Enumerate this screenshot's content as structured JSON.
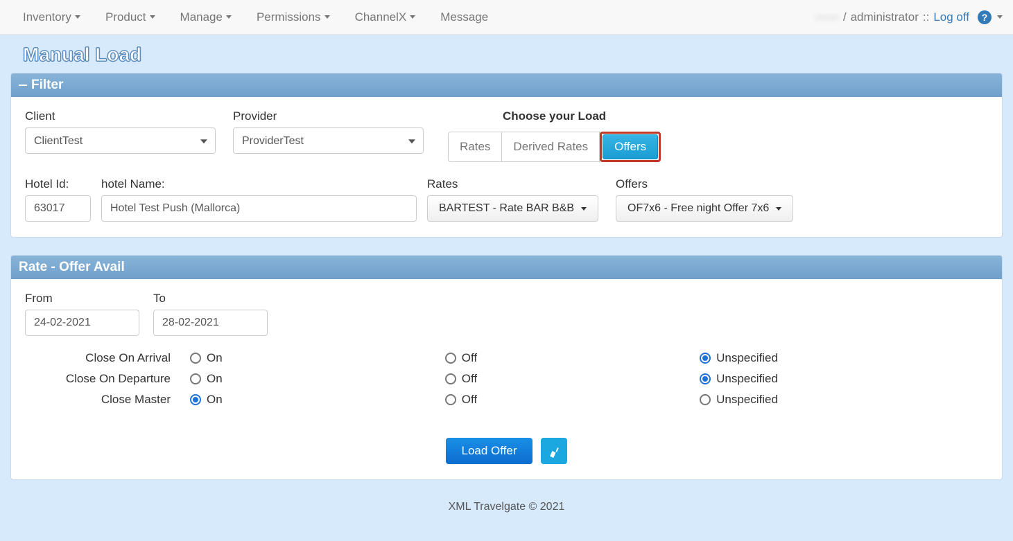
{
  "nav": {
    "items": [
      "Inventory",
      "Product",
      "Manage",
      "Permissions",
      "ChannelX",
      "Message"
    ],
    "user_masked": "------",
    "role": "administrator",
    "sep": "::",
    "logoff": "Log off"
  },
  "page_title": "Manual Load",
  "filter": {
    "header": "Filter",
    "client_label": "Client",
    "client_value": "ClientTest",
    "provider_label": "Provider",
    "provider_value": "ProviderTest",
    "choose_load_label": "Choose your Load",
    "tabs": {
      "rates": "Rates",
      "derived": "Derived Rates",
      "offers": "Offers"
    },
    "hotel_id_label": "Hotel Id:",
    "hotel_id_value": "63017",
    "hotel_name_label": "hotel Name:",
    "hotel_name_value": "Hotel Test Push (Mallorca)",
    "rates_label": "Rates",
    "rates_value": "BARTEST - Rate BAR B&B",
    "offers_label": "Offers",
    "offers_value": "OF7x6 - Free night Offer 7x6"
  },
  "avail": {
    "header": "Rate - Offer Avail",
    "from_label": "From",
    "from_value": "24-02-2021",
    "to_label": "To",
    "to_value": "28-02-2021",
    "rows": [
      {
        "label": "Close On Arrival",
        "selected": "unspecified"
      },
      {
        "label": "Close On Departure",
        "selected": "unspecified"
      },
      {
        "label": "Close Master",
        "selected": "on"
      }
    ],
    "opts": {
      "on": "On",
      "off": "Off",
      "unspecified": "Unspecified"
    },
    "load_btn": "Load Offer"
  },
  "footer": "XML Travelgate © 2021"
}
